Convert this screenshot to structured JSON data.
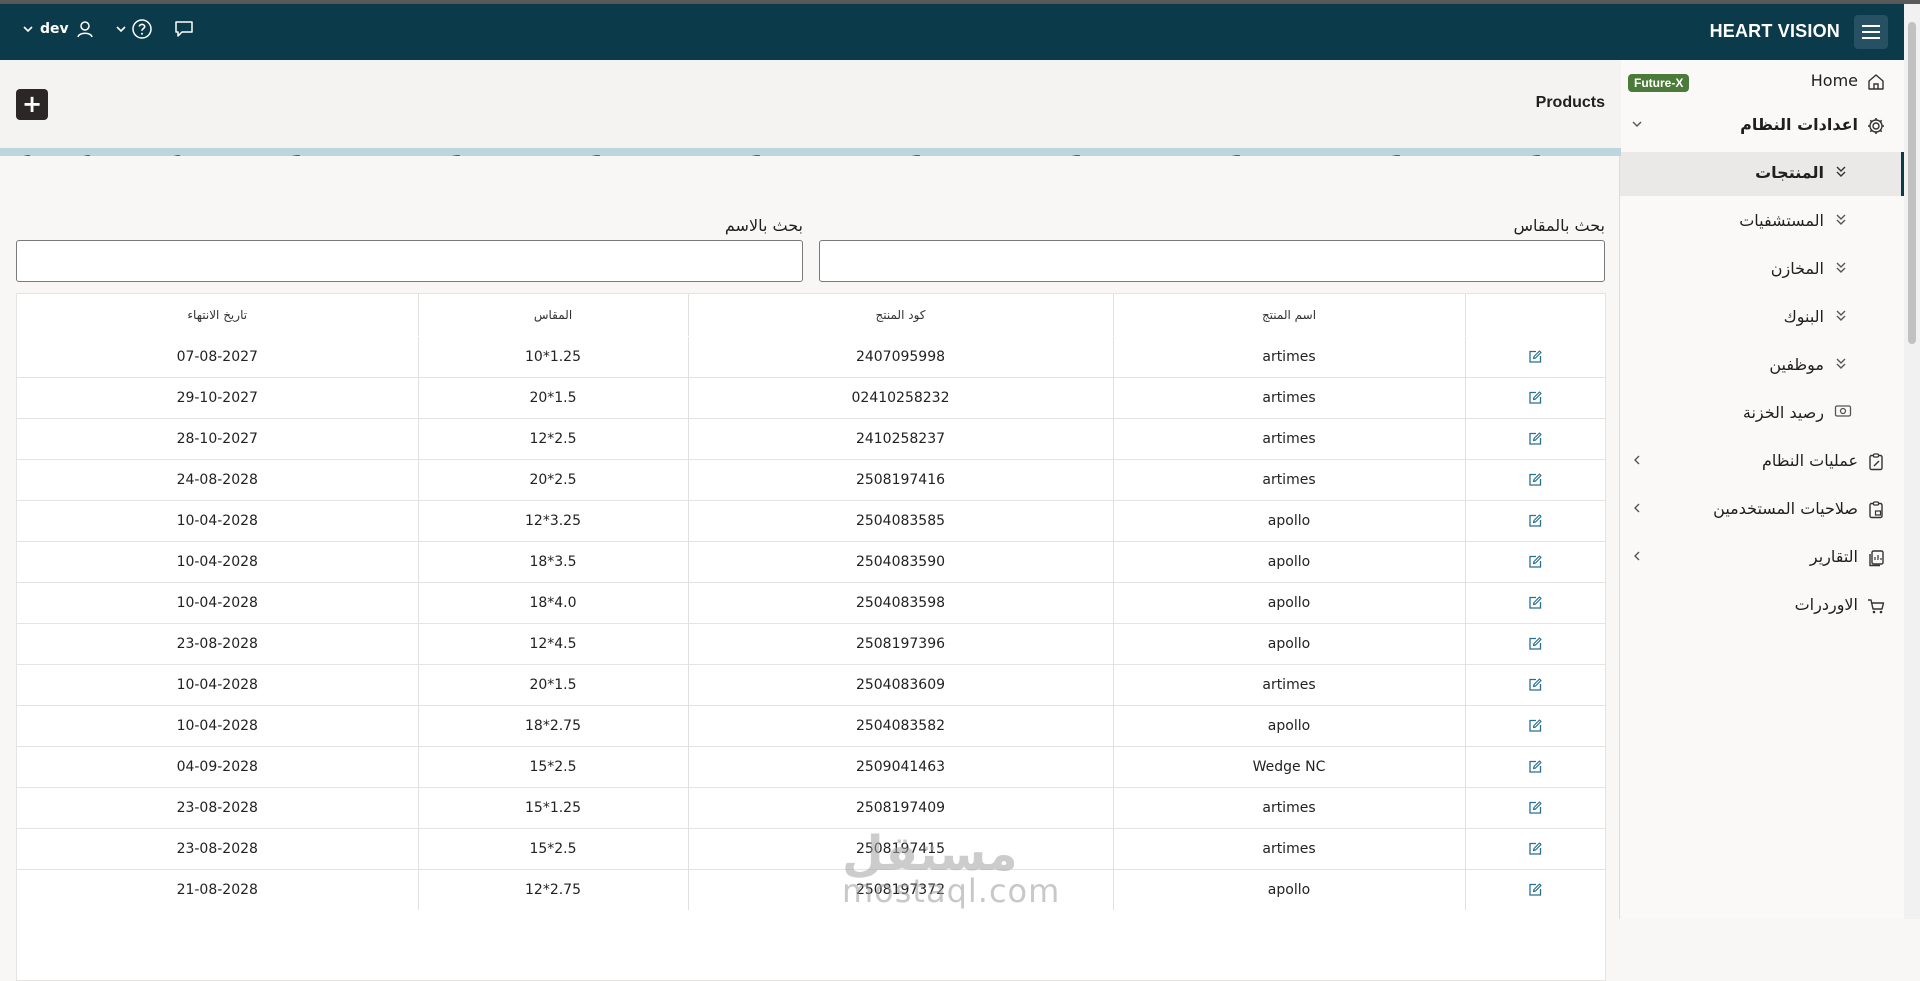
{
  "header": {
    "app_title": "HEART VISION",
    "user": "dev"
  },
  "sidebar": {
    "home": {
      "label": "Home",
      "badge": "Future-X"
    },
    "items": [
      {
        "label": "اعدادات النظام"
      },
      {
        "label": "المنتجات"
      },
      {
        "label": "المستشفيات"
      },
      {
        "label": "المخازن"
      },
      {
        "label": "البنوك"
      },
      {
        "label": "موظفين"
      },
      {
        "label": "رصيد الخزنة"
      },
      {
        "label": "عمليات النظام"
      },
      {
        "label": "صلاحيات المستخدمين"
      },
      {
        "label": "التقارير"
      },
      {
        "label": "الاوردرات"
      }
    ]
  },
  "page": {
    "title": "Products",
    "add_label": "+"
  },
  "search": {
    "by_size_label": "بحث بالمقاس",
    "by_name_label": "بحث بالاسم",
    "by_size_value": "",
    "by_name_value": ""
  },
  "table": {
    "headers": {
      "edit": "",
      "name": "اسم المنتج",
      "code": "كود المنتج",
      "size": "المقاس",
      "expiry": "تاريخ الانتهاء"
    },
    "rows": [
      {
        "name": "artimes",
        "code": "2407095998",
        "size": "10*1.25",
        "expiry": "07-08-2027"
      },
      {
        "name": "artimes",
        "code": "02410258232",
        "size": "20*1.5",
        "expiry": "29-10-2027"
      },
      {
        "name": "artimes",
        "code": "2410258237",
        "size": "12*2.5",
        "expiry": "28-10-2027"
      },
      {
        "name": "artimes",
        "code": "2508197416",
        "size": "20*2.5",
        "expiry": "24-08-2028"
      },
      {
        "name": "apollo",
        "code": "2504083585",
        "size": "12*3.25",
        "expiry": "10-04-2028"
      },
      {
        "name": "apollo",
        "code": "2504083590",
        "size": "18*3.5",
        "expiry": "10-04-2028"
      },
      {
        "name": "apollo",
        "code": "2504083598",
        "size": "18*4.0",
        "expiry": "10-04-2028"
      },
      {
        "name": "apollo",
        "code": "2508197396",
        "size": "12*4.5",
        "expiry": "23-08-2028"
      },
      {
        "name": "artimes",
        "code": "2504083609",
        "size": "20*1.5",
        "expiry": "10-04-2028"
      },
      {
        "name": "apollo",
        "code": "2504083582",
        "size": "18*2.75",
        "expiry": "10-04-2028"
      },
      {
        "name": "Wedge NC",
        "code": "2509041463",
        "size": "15*2.5",
        "expiry": "04-09-2028"
      },
      {
        "name": "artimes",
        "code": "2508197409",
        "size": "15*1.25",
        "expiry": "23-08-2028"
      },
      {
        "name": "artimes",
        "code": "2508197415",
        "size": "15*2.5",
        "expiry": "23-08-2028"
      },
      {
        "name": "apollo",
        "code": "2508197372",
        "size": "12*2.75",
        "expiry": "21-08-2028"
      }
    ]
  },
  "watermark": {
    "arabic": "مستقل",
    "latin": "mostaql.com"
  },
  "colors": {
    "header_bg": "#0b3a4b",
    "badge_bg": "#4c7a3a",
    "accent": "#2a6f8f"
  }
}
